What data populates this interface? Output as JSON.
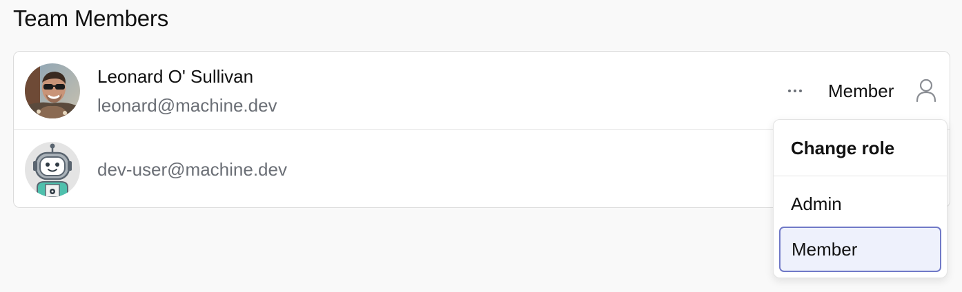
{
  "page": {
    "title": "Team Members"
  },
  "members": [
    {
      "name": "Leonard O' Sullivan",
      "email": "leonard@machine.dev",
      "role": "Member",
      "avatar": "photo-avatar"
    },
    {
      "name": "",
      "email": "dev-user@machine.dev",
      "avatar": "robot-avatar"
    }
  ],
  "row_actions": {
    "more_icon": "ellipsis-icon",
    "role_icon": "user-icon"
  },
  "role_menu": {
    "title": "Change role",
    "options": [
      "Admin",
      "Member"
    ],
    "selected": "Member"
  },
  "colors": {
    "background": "#f9f9f9",
    "card": "#ffffff",
    "muted_text": "#6b6f76",
    "selected_option_bg": "#eef1fc",
    "selected_option_border": "#7079c7"
  }
}
